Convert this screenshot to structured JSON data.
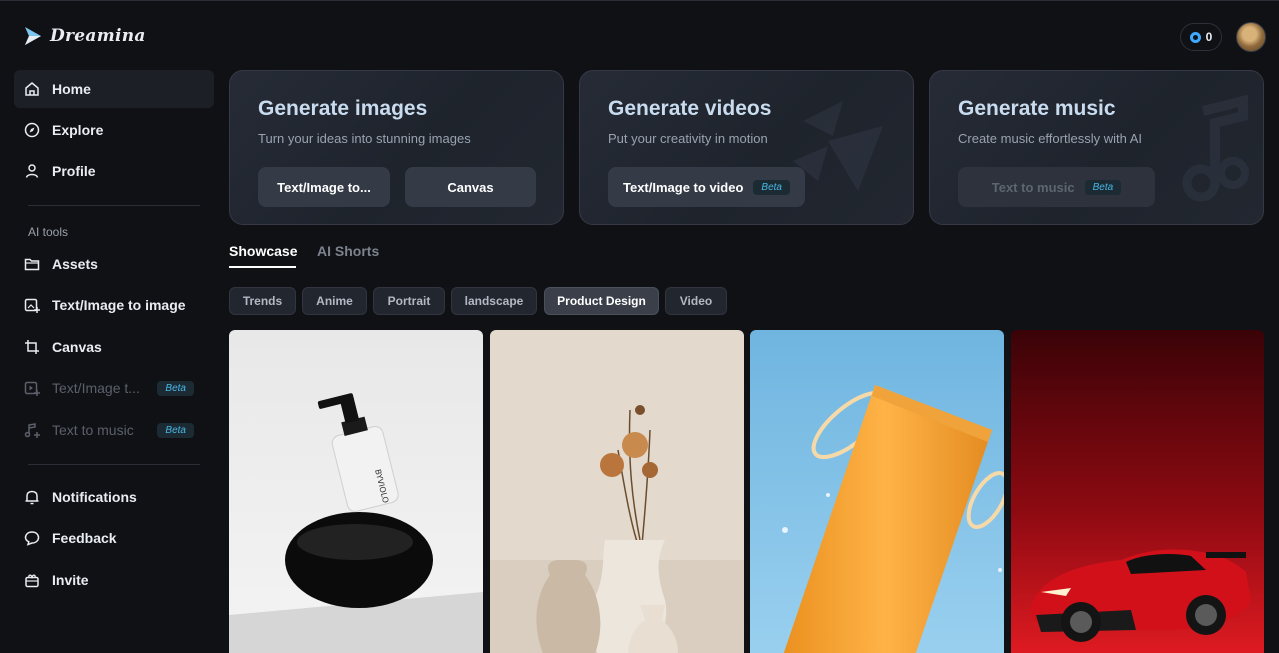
{
  "brand": {
    "name": "Dreamina"
  },
  "header": {
    "credits": "0"
  },
  "sidebar": {
    "nav": [
      {
        "label": "Home",
        "icon": "home-icon"
      },
      {
        "label": "Explore",
        "icon": "compass-icon"
      },
      {
        "label": "Profile",
        "icon": "user-icon"
      }
    ],
    "tools_label": "AI tools",
    "tools": [
      {
        "label": "Assets",
        "icon": "folder-icon"
      },
      {
        "label": "Text/Image to image",
        "icon": "image-plus-icon"
      },
      {
        "label": "Canvas",
        "icon": "crop-icon"
      },
      {
        "label": "Text/Image t...",
        "icon": "video-plus-icon",
        "badge": "Beta"
      },
      {
        "label": "Text to music",
        "icon": "music-plus-icon",
        "badge": "Beta"
      }
    ],
    "bottom": [
      {
        "label": "Notifications",
        "icon": "bell-icon"
      },
      {
        "label": "Feedback",
        "icon": "chat-icon"
      },
      {
        "label": "Invite",
        "icon": "gift-icon"
      }
    ]
  },
  "cards": [
    {
      "title": "Generate images",
      "subtitle": "Turn your ideas into stunning images",
      "buttons": [
        "Text/Image to...",
        "Canvas"
      ]
    },
    {
      "title": "Generate videos",
      "subtitle": "Put your creativity in motion",
      "buttons": [
        "Text/Image to video"
      ],
      "badge": "Beta"
    },
    {
      "title": "Generate music",
      "subtitle": "Create music effortlessly with AI",
      "buttons": [
        "Text to music"
      ],
      "badge": "Beta"
    }
  ],
  "tabs": [
    "Showcase",
    "AI Shorts"
  ],
  "chips": [
    "Trends",
    "Anime",
    "Portrait",
    "landscape",
    "Product Design",
    "Video"
  ],
  "active_chip": "Product Design",
  "gallery_label": "BYVIOLO"
}
